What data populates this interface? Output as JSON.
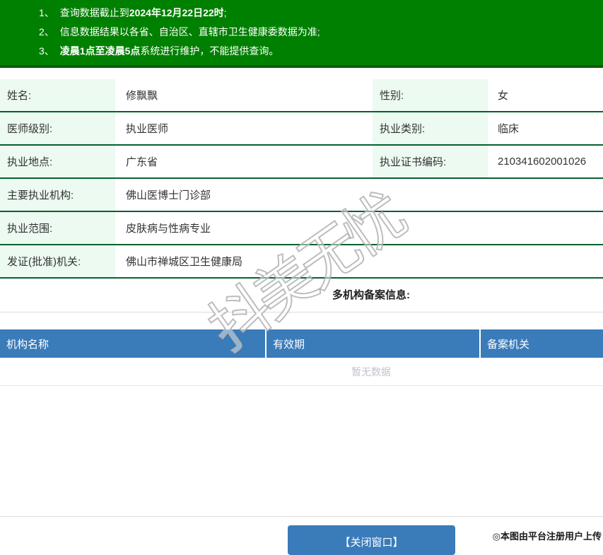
{
  "banner": {
    "notices": [
      {
        "num": "1、",
        "pre": "查询数据截止到",
        "bold": "2024年12月22日22时",
        "post": ";"
      },
      {
        "num": "2、",
        "pre": "信息数据结果以各省、自治区、直辖市卫生健康委数据为准;",
        "bold": "",
        "post": ""
      },
      {
        "num": "3、",
        "pre": "",
        "bold": "凌晨1点至凌晨5点",
        "post": "系统进行维护，不能提供查询。"
      }
    ]
  },
  "info": {
    "rows": [
      {
        "label1": "姓名:",
        "value1": "修飘飘",
        "label2": "性别:",
        "value2": "女"
      },
      {
        "label1": "医师级别:",
        "value1": "执业医师",
        "label2": "执业类别:",
        "value2": "临床"
      },
      {
        "label1": "执业地点:",
        "value1": "广东省",
        "label2": "执业证书编码:",
        "value2": "210341602001026"
      },
      {
        "label": "主要执业机构:",
        "value": "佛山医博士门诊部"
      },
      {
        "label": "执业范围:",
        "value": "皮肤病与性病专业"
      },
      {
        "label": "发证(批准)机关:",
        "value": "佛山市禅城区卫生健康局"
      }
    ]
  },
  "filing": {
    "section_title": "多机构备案信息:",
    "headers": [
      "机构名称",
      "有效期",
      "备案机关"
    ],
    "empty_text": "暂无数据"
  },
  "actions": {
    "close_label": "【关闭窗口】"
  },
  "watermark_text": "抖美无忧",
  "footer_note": "◎本图由平台注册用户上传",
  "colors": {
    "banner_green": "#008000",
    "banner_border_green": "#0b5c0b",
    "label_cell_green": "#ecfaf1",
    "row_separator_green": "#07612e",
    "table_header_blue": "#3a7bb9",
    "empty_text_gray": "#bfc3c9"
  }
}
